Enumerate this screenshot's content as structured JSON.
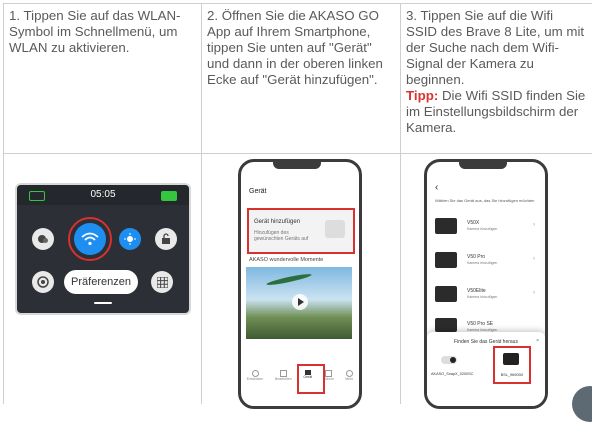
{
  "steps": [
    {
      "text": "1. Tippen Sie auf das WLAN-Symbol im Schnellmenü, um WLAN zu aktivieren."
    },
    {
      "text": "2. Öffnen Sie die AKASO GO App auf Ihrem Smartphone, tippen Sie unten auf \"Gerät\" und dann in der oberen linken Ecke auf \"Gerät hinzufügen\"."
    },
    {
      "text": "3. Tippen Sie auf die Wifi SSID des Brave 8 Lite, um mit der Suche nach dem Wifi-Signal der Kamera zu beginnen.",
      "tip_label": "Tipp:",
      "tip_text": " Die Wifi SSID finden Sie im Einstellungsbildschirm der Kamera."
    }
  ],
  "camera_screen": {
    "time": "05:05",
    "preferences_button": "Präferenzen"
  },
  "phone2": {
    "title": "Gerät",
    "add_device_title": "Gerät hinzufügen",
    "add_device_sub": "Hinzufügen des gewünschten Geräts auf",
    "moments_title": "AKASO wundervolle Momente",
    "nav": [
      "Entdecken",
      "Bearbeiten",
      "Gerät",
      "Album",
      "Mehr"
    ]
  },
  "phone3": {
    "header": "Wählen Sie das Gerät aus, das Sie hinzufügen möchten",
    "devices": [
      {
        "name": "V50X",
        "sub": "Kamera hinzufügen"
      },
      {
        "name": "V50 Pro",
        "sub": "Kamera hinzufügen"
      },
      {
        "name": "V50Elite",
        "sub": "Kamera hinzufügen"
      },
      {
        "name": "V50 Pro SE",
        "sub": "Kamera hinzufügen"
      }
    ],
    "popup_title": "Finden Sie das Gerät heraus",
    "popup_items": [
      "AKASO_SnapX_0200SC",
      "BSL_9690D0"
    ]
  },
  "colors": {
    "accent_red": "#d8312f",
    "wifi_blue": "#1e8ff0",
    "battery_green": "#35c53f"
  }
}
